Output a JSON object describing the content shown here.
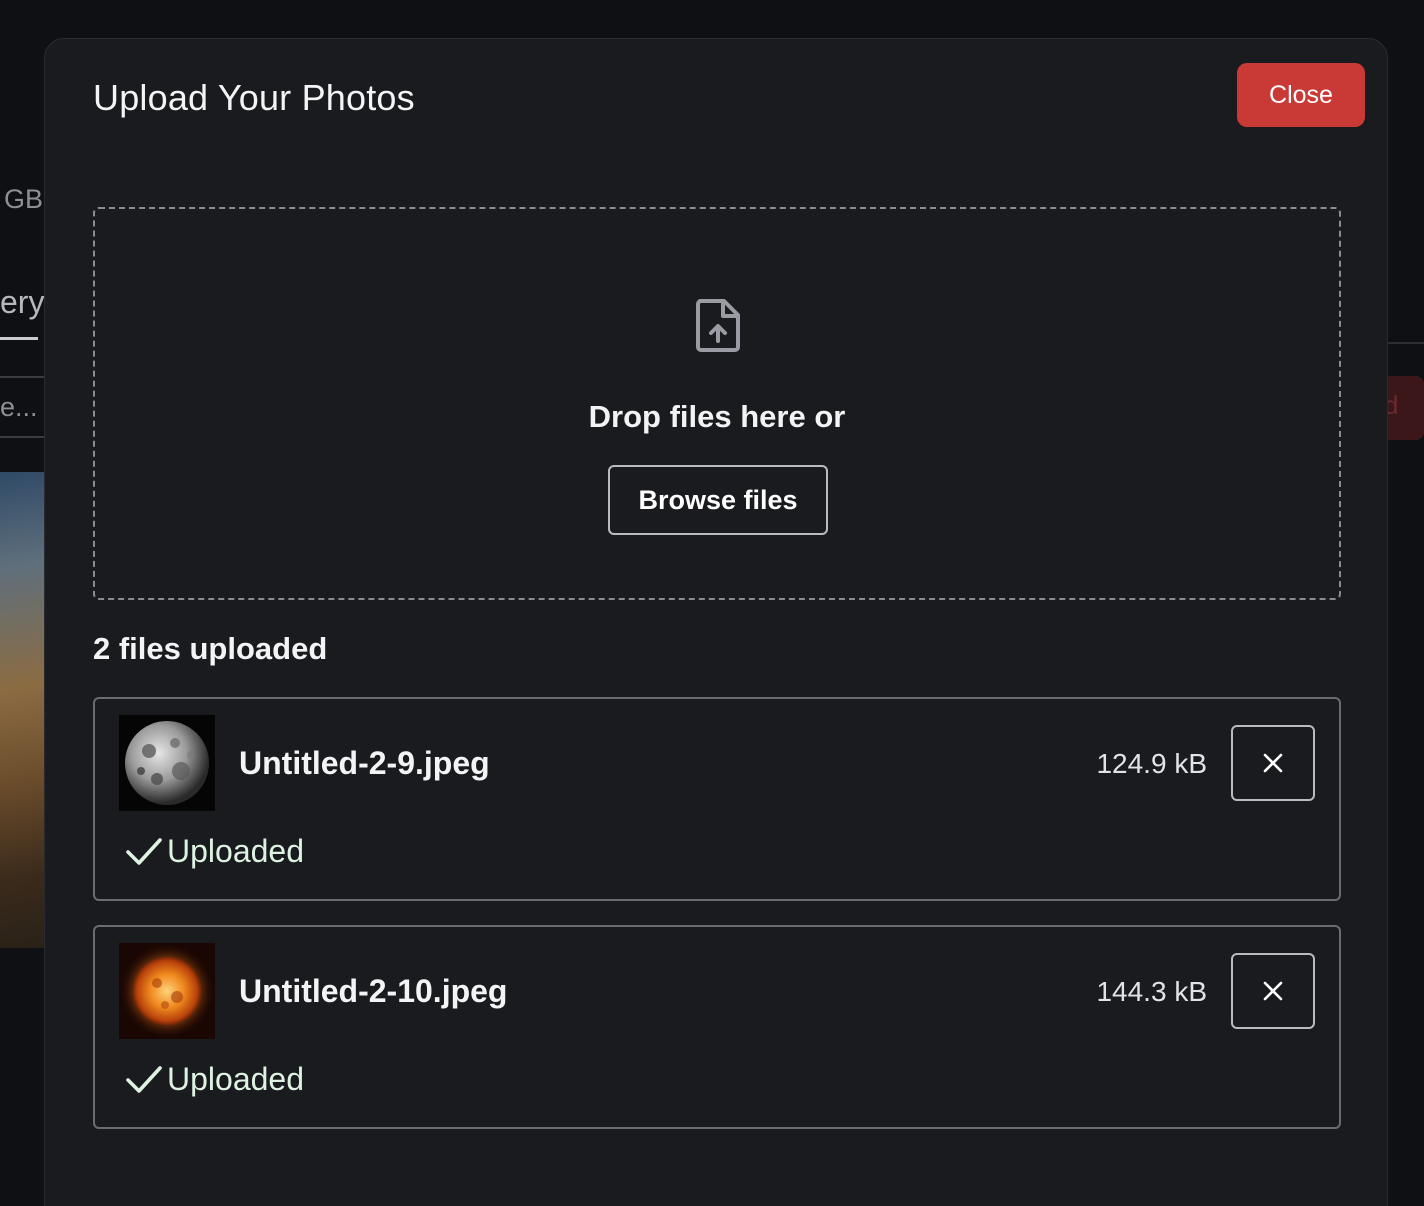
{
  "background": {
    "storage_fragment": "GB",
    "tab_fragment": "ery",
    "search_fragment": "e...",
    "button_fragment": "d"
  },
  "modal": {
    "title": "Upload Your Photos",
    "close_label": "Close",
    "close_color": "#c93a36"
  },
  "dropzone": {
    "icon": "file-upload-icon",
    "prompt": "Drop files here or",
    "browse_label": "Browse files"
  },
  "files": {
    "count_label": "2 files uploaded",
    "items": [
      {
        "name": "Untitled-2-9.jpeg",
        "size": "124.9 kB",
        "status": "Uploaded",
        "thumbnail": "moon-thumbnail"
      },
      {
        "name": "Untitled-2-10.jpeg",
        "size": "144.3 kB",
        "status": "Uploaded",
        "thumbnail": "sun-thumbnail"
      }
    ]
  },
  "colors": {
    "modal_bg": "#1a1b1e",
    "success_check": "#dff3e3"
  }
}
